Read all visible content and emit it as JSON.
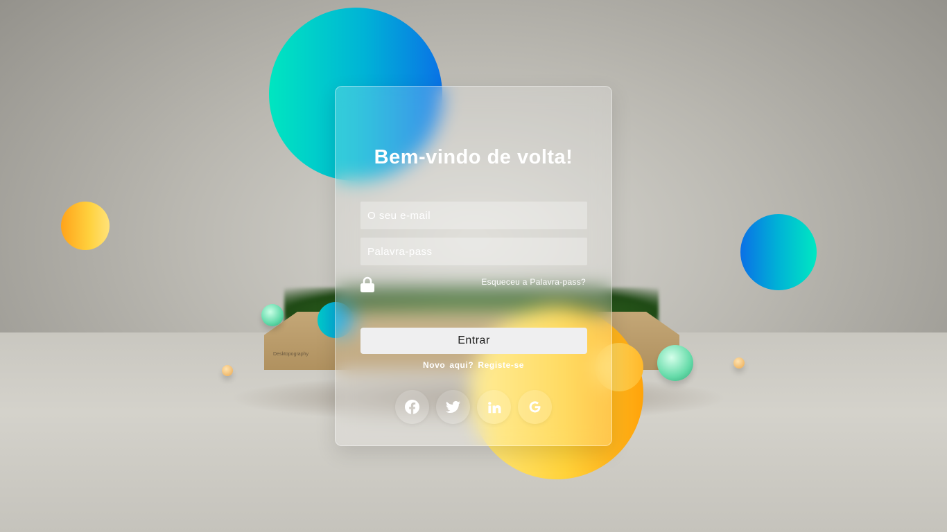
{
  "login": {
    "title": "Bem-vindo de volta!",
    "email_placeholder": "O seu e-mail",
    "password_placeholder": "Palavra-pass",
    "forgot_label": "Esqueceu a Palavra-pass?",
    "submit_label": "Entrar",
    "signup_prefix_1": "Novo",
    "signup_prefix_2": "aqui?",
    "signup_label": "Registe-se"
  },
  "background": {
    "planter_caption": "Desktopography"
  },
  "socials": [
    {
      "icon": "facebook-icon"
    },
    {
      "icon": "twitter-icon"
    },
    {
      "icon": "linkedin-icon"
    },
    {
      "icon": "google-icon"
    }
  ],
  "colors": {
    "accent_teal": "#00e6c0",
    "accent_blue": "#0a72e6",
    "accent_orange": "#ffa31a",
    "accent_yellow": "#ffd23a",
    "button_bg": "#efeff0"
  }
}
